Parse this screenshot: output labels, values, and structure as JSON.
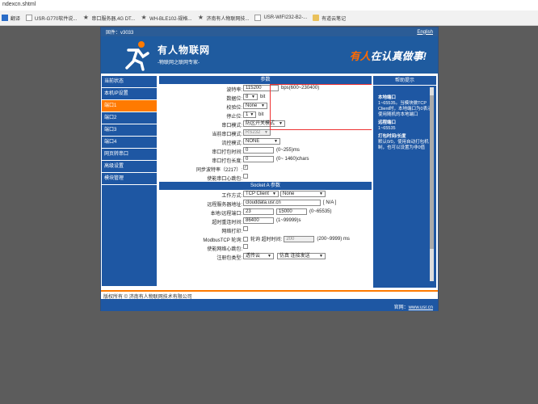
{
  "browser": {
    "url": "ndexcn.shtml",
    "bookmarks": [
      {
        "label": "翻译",
        "icon": "translate-icon"
      },
      {
        "label": "USR-G770软件说...",
        "icon": "document-icon"
      },
      {
        "label": "串口服务器,4G DT...",
        "icon": "usr-icon"
      },
      {
        "label": "WH-BLE102-规格...",
        "icon": "usr-icon"
      },
      {
        "label": "济南有人物联网技...",
        "icon": "usr-icon"
      },
      {
        "label": "USR-WIFI232-B2-...",
        "icon": "document-icon"
      },
      {
        "label": "有道云笔记",
        "icon": "folder-icon"
      }
    ]
  },
  "topbar": {
    "firmware": "固件：v3033",
    "language_link": "English"
  },
  "header": {
    "brand": "有人物联网",
    "brand_sub": "-物联网之联网专家-",
    "slogan_highlight": "有人",
    "slogan_rest": "在认真做事!"
  },
  "menu": {
    "items": [
      {
        "label": "当前状态",
        "active": false
      },
      {
        "label": "本机IP设置",
        "active": false
      },
      {
        "label": "端口1",
        "active": true
      },
      {
        "label": "端口2",
        "active": false
      },
      {
        "label": "端口3",
        "active": false
      },
      {
        "label": "端口4",
        "active": false
      },
      {
        "label": "网页转串口",
        "active": false
      },
      {
        "label": "高级设置",
        "active": false
      },
      {
        "label": "模块管理",
        "active": false
      }
    ]
  },
  "params": {
    "section_title": "参数",
    "baud_label": "波特率:",
    "baud_value": "115200",
    "baud_unit": "bps(600~230400)",
    "databits_label": "数据位:",
    "databits_value": "8",
    "databits_unit": "bit",
    "parity_label": "校验位:",
    "parity_value": "None",
    "stopbits_label": "停止位:",
    "stopbits_value": "1",
    "stopbits_unit": "bit",
    "serial_mode_label": "串口模式:",
    "serial_mode_value": "防区开关模式",
    "current_serial_label": "当前串口模式:",
    "current_serial_value": "RS232",
    "flow_label": "流控模式:",
    "flow_value": "NONE",
    "pack_time_label": "串口打包时间:",
    "pack_time_value": "0",
    "pack_time_unit": "(0~255)ms",
    "pack_len_label": "串口打包长度:",
    "pack_len_value": "0",
    "pack_len_unit": "(0~ 1460)chars",
    "sync_baud_label": "同步波特率（2217）:",
    "sync_baud_checked": "✓",
    "heartbeat_label": "使能串口心跳包:"
  },
  "socket": {
    "section_title": "Socket A 参数",
    "work_mode_label": "工作方式:",
    "work_mode_value": "TCP Client",
    "work_mode_sub": "None",
    "server_label": "远程服务器地址:",
    "server_value": "clouddata.usr.cn",
    "server_suffix": "[ N/A ]",
    "ports_label": "本地/远程端口:",
    "local_port": "23",
    "remote_port": "15000",
    "ports_unit": "(0~65535)",
    "reconnect_label": "超时重连时间:",
    "reconnect_value": "86400",
    "reconnect_unit": "(1~99999)s",
    "print_label": "网络打印:",
    "modbus_label": "ModbusTCP 轮询:",
    "modbus_poll_text": "轮询 超时时间:",
    "modbus_timeout": "200",
    "modbus_unit": "(200~9999) ms",
    "net_heartbeat_label": "使能网络心跳包:",
    "reg_type_label": "注册包类型:",
    "reg_type_value": "透传云",
    "reg_type_extra": "仿真 连接发送"
  },
  "help": {
    "title": "帮助提示",
    "sections": [
      {
        "title": "本地端口",
        "body": "1~65535。当模块做TCP Client时，本地端口为0表示使用随机的本地端口"
      },
      {
        "title": "远程端口",
        "body": "1~65535"
      },
      {
        "title": "打包时间/长度",
        "body": "默认0/0，使用自动打包机制，也可以设置为非0值"
      }
    ]
  },
  "footer": {
    "copyright": "版权所有 © 济南有人物联网技术有限公司",
    "site_label": "官网：",
    "site_link": "www.usr.cn"
  }
}
